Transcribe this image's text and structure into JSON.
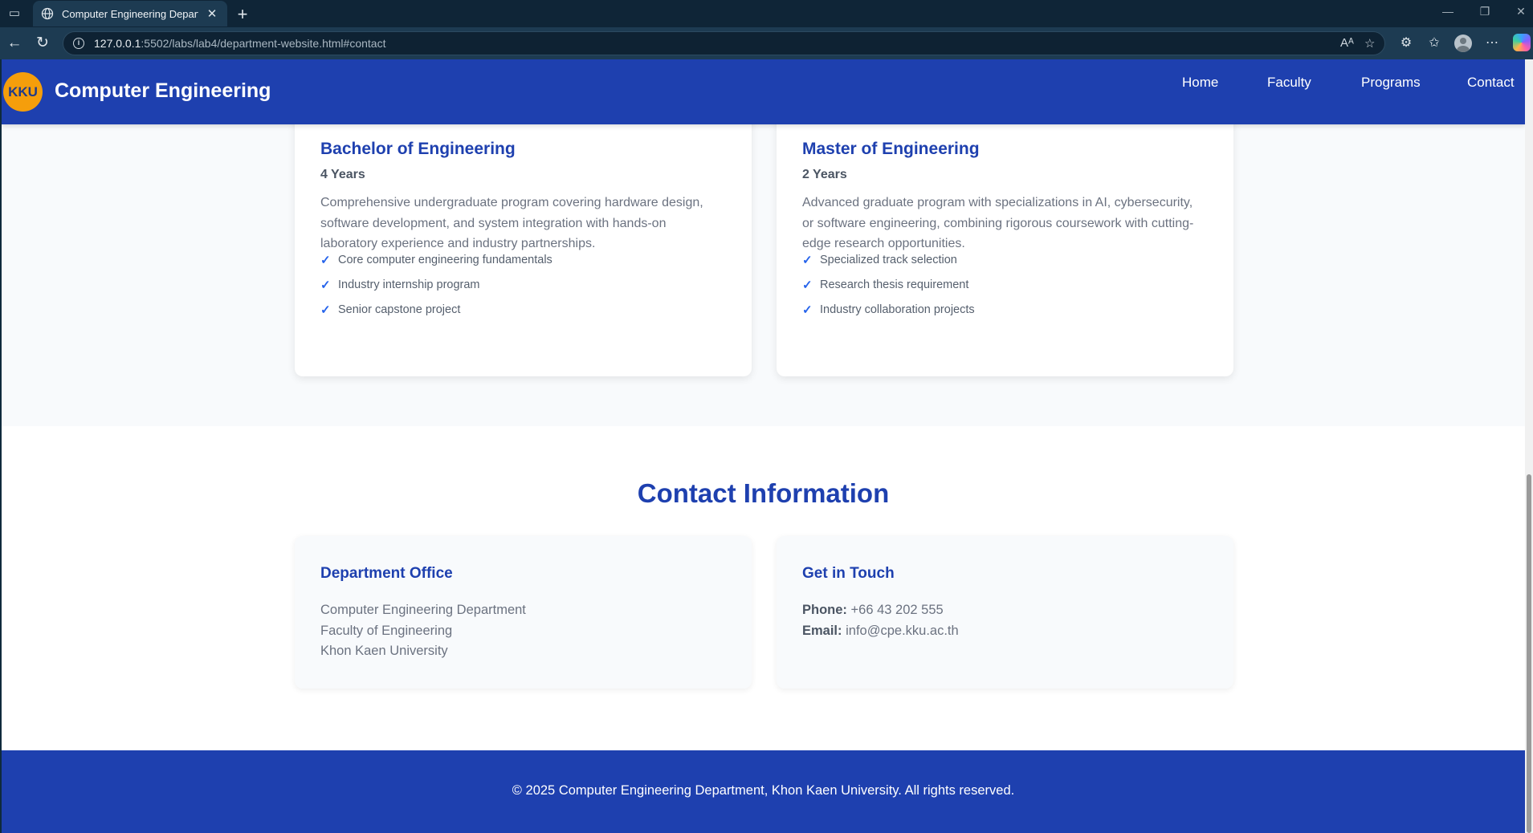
{
  "browser": {
    "tab_title": "Computer Engineering Departme",
    "url_host": "127.0.0.1",
    "url_path": ":5502/labs/lab4/department-website.html#contact"
  },
  "header": {
    "logo_text": "KKU",
    "site_title": "Computer Engineering",
    "nav": [
      "Home",
      "Faculty",
      "Programs",
      "Contact"
    ]
  },
  "programs": [
    {
      "title": "Bachelor of Engineering",
      "duration": "4 Years",
      "description": "Comprehensive undergraduate program covering hardware design, software development, and system integration with hands-on laboratory experience and industry partnerships.",
      "features": [
        "Core computer engineering fundamentals",
        "Industry internship program",
        "Senior capstone project"
      ]
    },
    {
      "title": "Master of Engineering",
      "duration": "2 Years",
      "description": "Advanced graduate program with specializations in AI, cybersecurity, or software engineering, combining rigorous coursework with cutting-edge research opportunities.",
      "features": [
        "Specialized track selection",
        "Research thesis requirement",
        "Industry collaboration projects"
      ]
    }
  ],
  "contact": {
    "title": "Contact Information",
    "office": {
      "heading": "Department Office",
      "lines": [
        "Computer Engineering Department",
        "Faculty of Engineering",
        "Khon Kaen University"
      ]
    },
    "touch": {
      "heading": "Get in Touch",
      "phone_label": "Phone:",
      "phone": "+66 43 202 555",
      "email_label": "Email:",
      "email": "info@cpe.kku.ac.th"
    }
  },
  "footer": {
    "text": "© 2025 Computer Engineering Department, Khon Kaen University. All rights reserved."
  },
  "icons": {
    "check": "✓"
  },
  "colors": {
    "brand_blue": "#1e40af",
    "logo_orange": "#f59e0b",
    "check_blue": "#2563eb"
  }
}
